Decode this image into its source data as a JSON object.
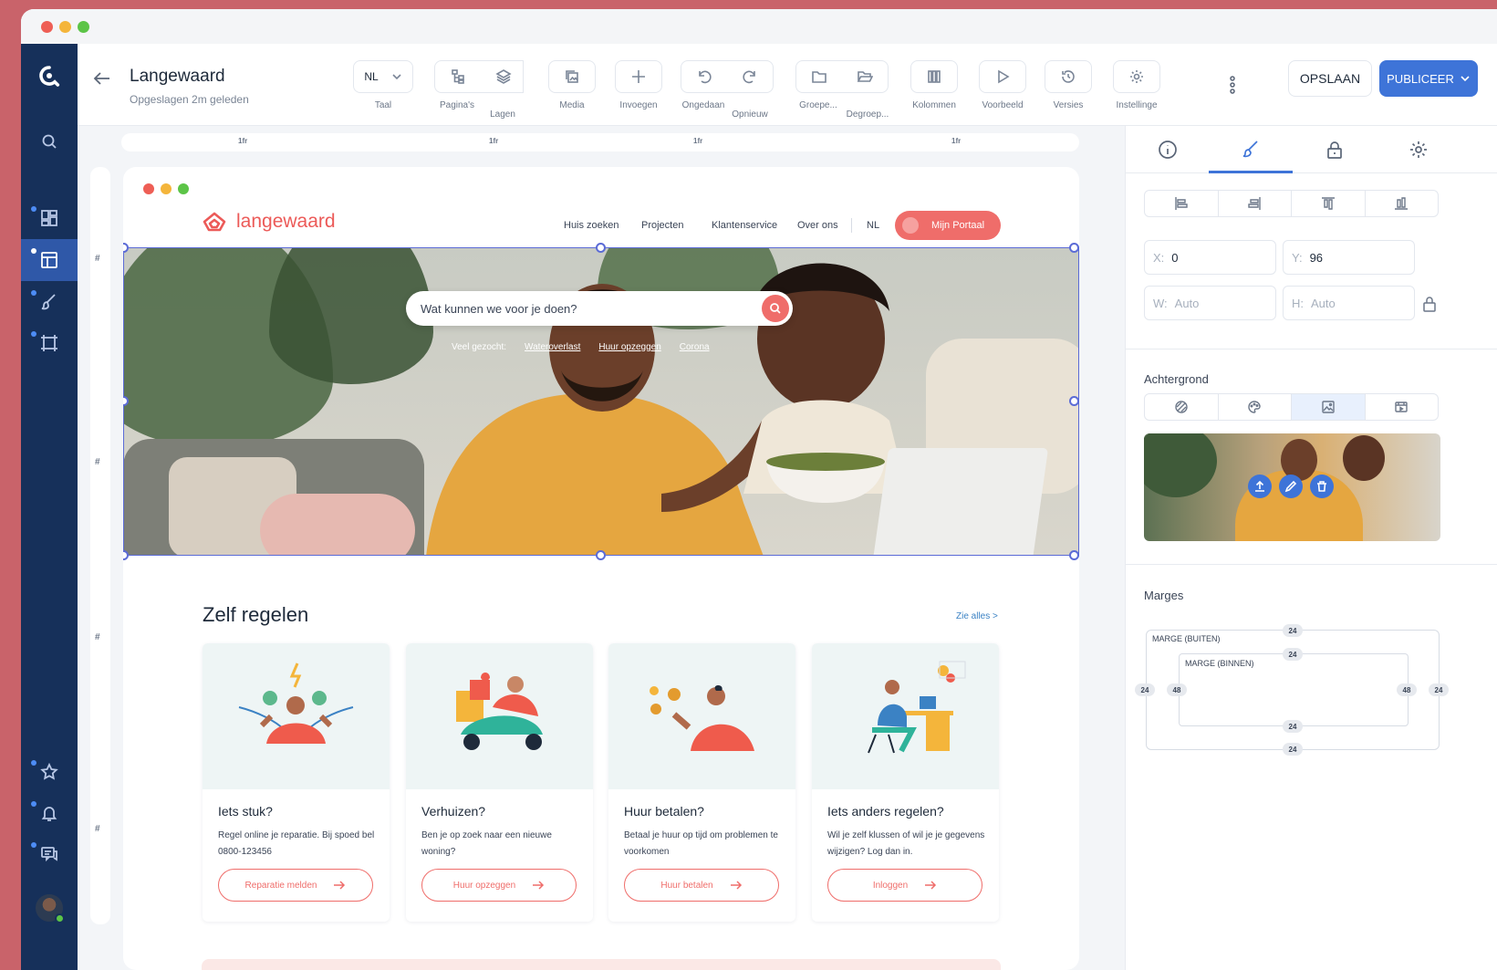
{
  "window": {
    "traffic_colors": [
      "#ee5e55",
      "#f4b53b",
      "#5cc447"
    ]
  },
  "document": {
    "title": "Langewaard",
    "subtitle": "Opgeslagen 2m geleden"
  },
  "toolbar": {
    "language": {
      "value": "NL",
      "label": "Taal"
    },
    "tools": [
      {
        "label": "Pagina's",
        "icon": "sitemap-icon"
      },
      {
        "label": "Lagen",
        "icon": "layers-icon"
      },
      {
        "label": "Media",
        "icon": "media-icon"
      },
      {
        "label": "Invoegen",
        "icon": "plus-icon"
      },
      {
        "label": "Ongedaan",
        "icon": "undo-icon"
      },
      {
        "label": "Opnieuw",
        "icon": "redo-icon"
      },
      {
        "label": "Groepe...",
        "icon": "folder-icon"
      },
      {
        "label": "Degroep...",
        "icon": "folder-open-icon"
      },
      {
        "label": "Kolommen",
        "icon": "columns-icon"
      },
      {
        "label": "Voorbeeld",
        "icon": "play-icon"
      },
      {
        "label": "Versies",
        "icon": "history-icon"
      },
      {
        "label": "Instellinge",
        "icon": "gear-icon"
      }
    ],
    "save_label": "OPSLAAN",
    "publish_label": "PUBLICEER"
  },
  "rulers": {
    "col_label": "1fr",
    "row_label": "#"
  },
  "site": {
    "brand": "langewaard",
    "nav": [
      "Huis zoeken",
      "Projecten",
      "Klantenservice",
      "Over ons",
      "NL"
    ],
    "portal_label": "Mijn Portaal",
    "search_placeholder": "Wat kunnen we voor je doen?",
    "popular_label": "Veel gezocht:",
    "popular_links": [
      "Wateroverlast",
      "Huur opzeggen",
      "Corona"
    ],
    "section_title": "Zelf regelen",
    "see_all": "Zie alles >",
    "cards": [
      {
        "title": "Iets stuk?",
        "text": "Regel online je reparatie. Bij spoed bel 0800-123456",
        "button": "Reparatie melden"
      },
      {
        "title": "Verhuizen?",
        "text": "Ben je op zoek naar een nieuwe woning?",
        "button": "Huur opzeggen"
      },
      {
        "title": "Huur betalen?",
        "text": "Betaal je huur op tijd om problemen te voorkomen",
        "button": "Huur betalen"
      },
      {
        "title": "Iets anders regelen?",
        "text": "Wil je zelf klussen of wil je je gegevens wijzigen? Log dan in.",
        "button": "Inloggen"
      }
    ]
  },
  "panel": {
    "fields": {
      "x": {
        "key": "X:",
        "value": "0"
      },
      "y": {
        "key": "Y:",
        "value": "96"
      },
      "w": {
        "key": "W:",
        "value": "Auto"
      },
      "h": {
        "key": "H:",
        "value": "Auto"
      }
    },
    "background_label": "Achtergrond",
    "margins_label": "Marges",
    "margin_outer_label": "MARGE (BUITEN)",
    "margin_inner_label": "MARGE (BINNEN)",
    "margins": {
      "outer": {
        "top": "24",
        "bottom": "24",
        "left": "24",
        "right": "24"
      },
      "inner": {
        "top": "24",
        "bottom": "24",
        "left": "48",
        "right": "48"
      }
    }
  },
  "colors": {
    "accent": "#3e74d8",
    "brand": "#ef6d6a",
    "rail": "#16305a",
    "selection": "#5b6bd6"
  }
}
